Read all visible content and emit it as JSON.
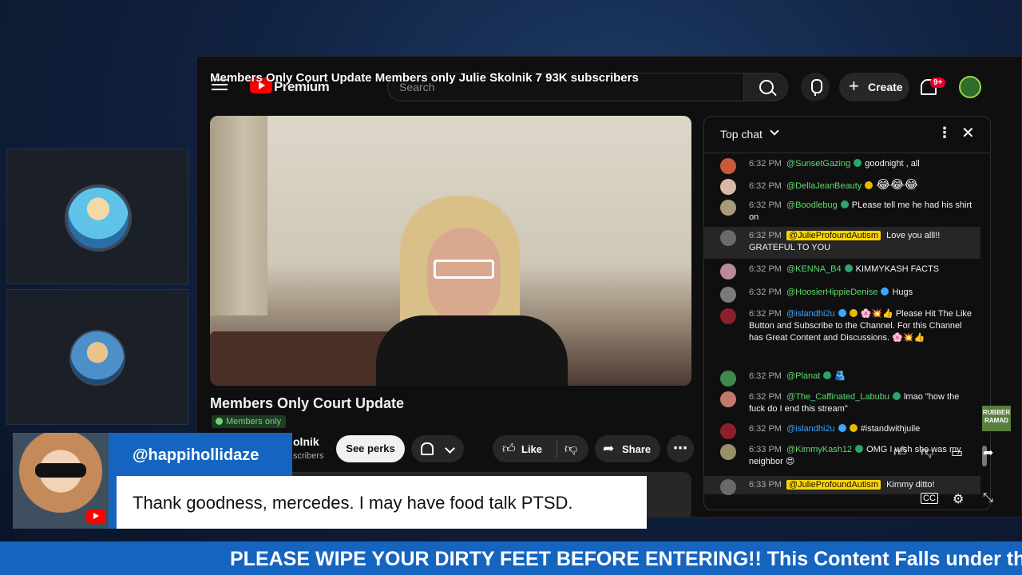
{
  "screen_share": {
    "title_overlay": "Members Only Court Update Members only  Julie Skolnik 7 93K subscribers",
    "youtube": {
      "logo_text": "Premium",
      "search_placeholder": "Search",
      "create_label": "Create",
      "notification_badge": "9+",
      "video_title": "Members Only Court Update",
      "members_badge": "Members only",
      "channel_name": "olnik",
      "channel_subs": "scribers",
      "see_perks_label": "See perks",
      "like_label": "Like",
      "share_label": "Share"
    },
    "chat": {
      "mode_label": "Top chat",
      "messages": [
        {
          "time": "6:32 PM",
          "author": "@SunsetGazing",
          "text": "goodnight , all"
        },
        {
          "time": "6:32 PM",
          "author": "@DellaJeanBeauty",
          "text": "😂😂😂"
        },
        {
          "time": "6:32 PM",
          "author": "@Boodlebug",
          "text": "PLease tell me he had his shirt on"
        },
        {
          "time": "6:32 PM",
          "author": "@JulieProfoundAutism",
          "text": "Love you alll!! GRATEFUL TO YOU"
        },
        {
          "time": "6:32 PM",
          "author": "@KENNA_B4",
          "text": "KIMMYKASH FACTS"
        },
        {
          "time": "6:32 PM",
          "author": "@HoosierHippieDenise",
          "text": "Hugs"
        },
        {
          "time": "6:32 PM",
          "author": "@islandhi2u",
          "text": "🌸💥👍 Please Hit The Like Button and Subscribe to the Channel. For this Channel has Great Content and Discussions. 🌸💥👍"
        },
        {
          "time": "6:32 PM",
          "author": "@Planat",
          "text": "🫂"
        },
        {
          "time": "6:32 PM",
          "author": "@The_Caffinated_Labubu",
          "text": "lmao \"how the fuck do I end this stream\""
        },
        {
          "time": "6:32 PM",
          "author": "@islandhi2u",
          "text": "#istandwithjuile"
        },
        {
          "time": "6:33 PM",
          "author": "@KimmyKash12",
          "text": "OMG I wish she was my neighbor 😍"
        },
        {
          "time": "6:33 PM",
          "author": "@JulieProfoundAutism",
          "text": "Kimmy ditto!"
        }
      ]
    },
    "side_tag": "RUBBER RAMAD"
  },
  "comment_card": {
    "handle": "@happihollidaze",
    "text": "Thank goodness, mercedes. I may have food talk PTSD."
  },
  "ticker": {
    "text": "PLEASE WIPE YOUR DIRTY FEET BEFORE ENTERING!! This Content Falls under th"
  },
  "colors": {
    "accent_blue": "#1565c0",
    "youtube_red": "#ff0000",
    "chat_author_green": "#5fd96f",
    "owner_highlight": "#ffd600"
  },
  "icons": [
    "hamburger-icon",
    "search-icon",
    "mic-icon",
    "bell-icon",
    "close-icon",
    "kebab-icon",
    "thumbs-up-icon",
    "thumbs-down-icon",
    "share-icon",
    "cc-icon",
    "settings-icon",
    "exit-fullscreen-icon"
  ]
}
